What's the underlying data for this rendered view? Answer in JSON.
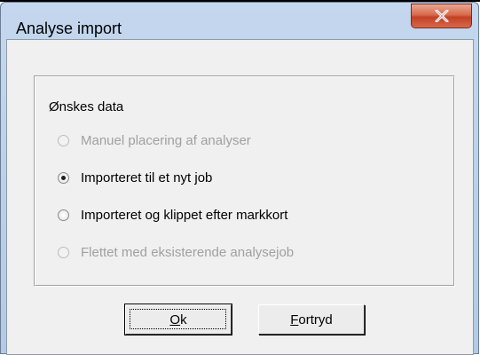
{
  "window": {
    "title": "Analyse import",
    "close_icon": "close-x-icon"
  },
  "group": {
    "label": "Ønskes data",
    "options": [
      {
        "label": "Manuel placering af analyser",
        "enabled": false,
        "selected": false
      },
      {
        "label": "Importeret til et nyt job",
        "enabled": true,
        "selected": true
      },
      {
        "label": "Importeret og klippet efter markkort",
        "enabled": true,
        "selected": false
      },
      {
        "label": "Flettet med eksisterende analysejob",
        "enabled": false,
        "selected": false
      }
    ]
  },
  "buttons": {
    "ok": {
      "mnemonic": "O",
      "rest": "k"
    },
    "cancel": {
      "mnemonic": "F",
      "rest": "ortryd"
    }
  },
  "colors": {
    "titlebar": "#c4d7ee",
    "close_button": "#c24125",
    "dialog_background": "#f0f0f0",
    "disabled_text": "#a0a0a0"
  }
}
